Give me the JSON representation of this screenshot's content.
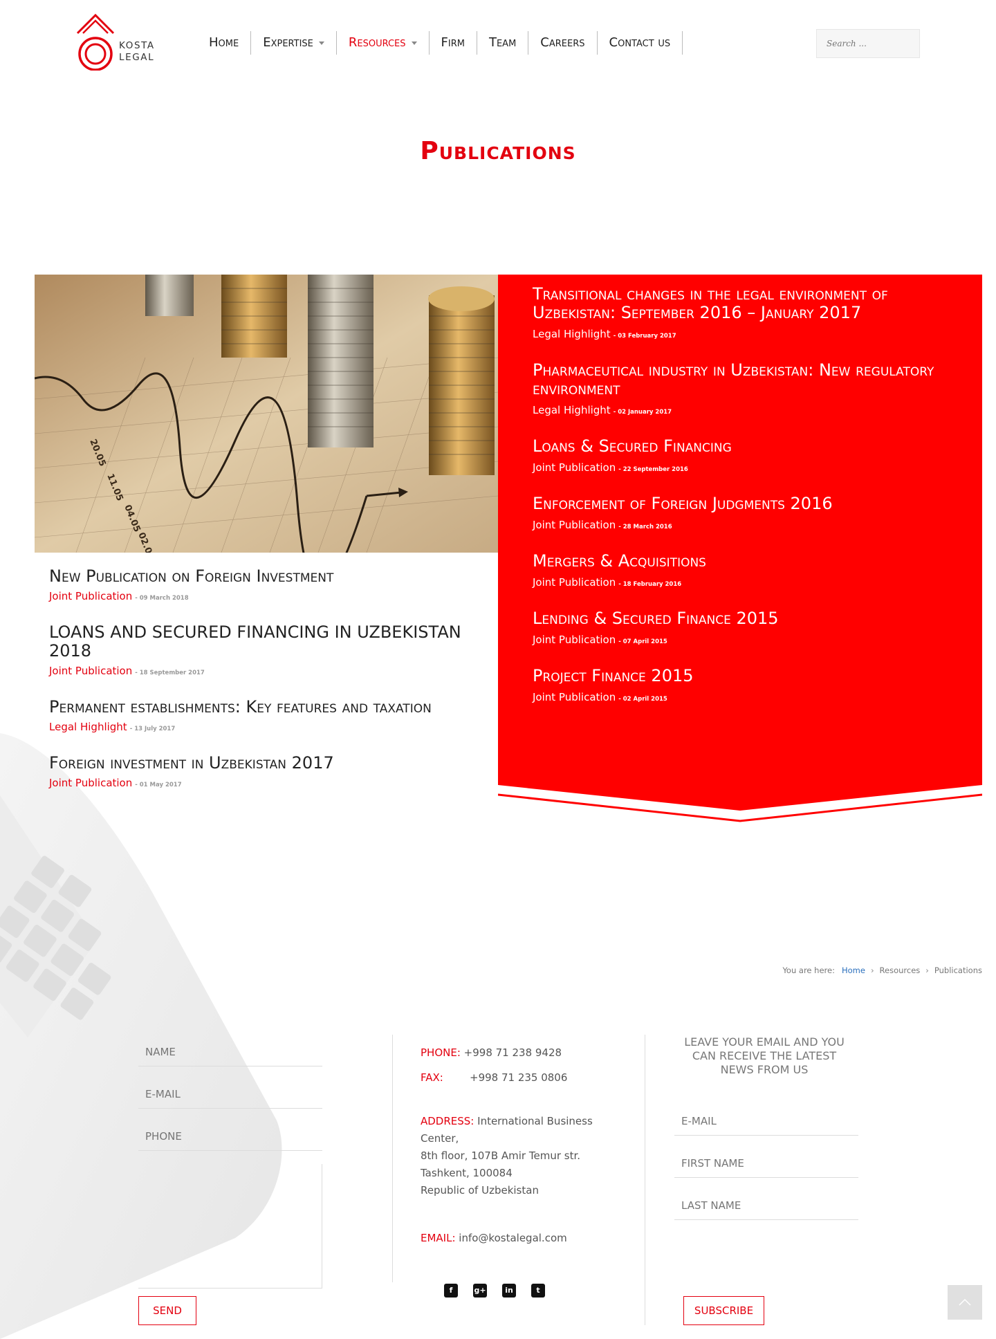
{
  "brand": {
    "line1": "KOSTA",
    "line2": "LEGAL",
    "accent": "#e3000f"
  },
  "nav": {
    "items": [
      {
        "label": "Home"
      },
      {
        "label": "Expertise"
      },
      {
        "label": "Resources"
      },
      {
        "label": "Firm"
      },
      {
        "label": "Team"
      },
      {
        "label": "Careers"
      },
      {
        "label": "Contact us"
      }
    ],
    "active": "Resources"
  },
  "search": {
    "placeholder": "Search ..."
  },
  "page": {
    "title": "Publications"
  },
  "left_publications": [
    {
      "title": "New Publication on Foreign Investment",
      "category": "Joint Publication",
      "date": "- 09 March 2018"
    },
    {
      "title": "LOANS AND SECURED FINANCING IN UZBEKISTAN 2018",
      "category": "Joint Publication",
      "date": "- 18 September 2017"
    },
    {
      "title": "Permanent establishments: Key features and taxation",
      "category": "Legal Highlight",
      "date": "- 13 July 2017"
    },
    {
      "title": "Foreign investment in Uzbekistan 2017",
      "category": "Joint Publication",
      "date": "- 01 May 2017"
    }
  ],
  "right_publications": [
    {
      "title": "Transitional changes in the legal environment of Uzbekistan: September 2016 – January 2017",
      "category": "Legal Highlight",
      "date": "- 03 February 2017"
    },
    {
      "title": "Pharmaceutical industry in Uzbekistan: New regulatory environment",
      "category": "Legal Highlight",
      "date": "- 02 January 2017"
    },
    {
      "title": "Loans & Secured Financing",
      "category": "Joint Publication",
      "date": "- 22 September 2016"
    },
    {
      "title": "Enforcement of Foreign Judgments 2016",
      "category": "Joint Publication",
      "date": "- 28 March 2016"
    },
    {
      "title": "Mergers & Acquisitions",
      "category": "Joint Publication",
      "date": "- 18 February 2016"
    },
    {
      "title": "Lending & Secured Finance 2015",
      "category": "Joint Publication",
      "date": "- 07 April 2015"
    },
    {
      "title": "Project Finance 2015",
      "category": "Joint Publication",
      "date": "- 02 April 2015"
    }
  ],
  "breadcrumb": {
    "prefix": "You are here:",
    "items": [
      "Home",
      "Resources",
      "Publications"
    ]
  },
  "contact_form": {
    "name_placeholder": "NAME",
    "email_placeholder": "E-MAIL",
    "phone_placeholder": "PHONE",
    "send_label": "SEND"
  },
  "contact": {
    "phone_label": "PHONE:",
    "phone": "+998 71 238 9428",
    "fax_label": "FAX:",
    "fax": "+998 71 235 0806",
    "address_label": "ADDRESS:",
    "address_line1": "International Business Center,",
    "address_line2": "8th floor, 107B Amir Temur str.",
    "address_line3": "Tashkent, 100084",
    "address_line4": "Republic of Uzbekistan",
    "email_label": "EMAIL:",
    "email": "info@kostalegal.com"
  },
  "socials": [
    {
      "icon": "facebook-icon",
      "glyph": "f"
    },
    {
      "icon": "google-plus-icon",
      "glyph": "g+"
    },
    {
      "icon": "linkedin-icon",
      "glyph": "in"
    },
    {
      "icon": "twitter-icon",
      "glyph": "t"
    }
  ],
  "newsletter": {
    "heading": "LEAVE YOUR EMAIL AND YOU CAN RECEIVE THE LATEST NEWS FROM US",
    "email_placeholder": "E-MAIL",
    "first_name_placeholder": "FIRST NAME",
    "last_name_placeholder": "LAST NAME",
    "subscribe_label": "SUBSCRIBE"
  }
}
